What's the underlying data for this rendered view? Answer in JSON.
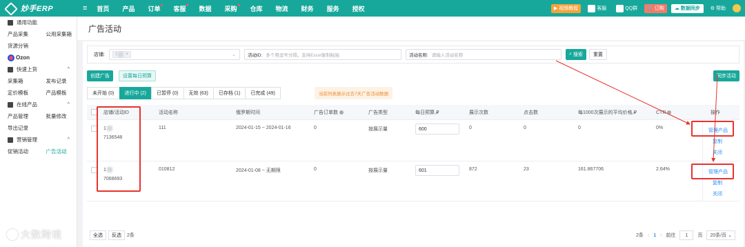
{
  "header": {
    "logo_text": "妙手ERP",
    "nav": [
      "首页",
      "产品",
      "订单",
      "客服",
      "数据",
      "采购",
      "仓库",
      "物流",
      "财务",
      "服务",
      "授权"
    ],
    "nav_dots": [
      false,
      false,
      true,
      true,
      false,
      true,
      false,
      false,
      false,
      false,
      false
    ],
    "video_tutorial": "视频教程",
    "customer_service": "客服",
    "qq_group": "QQ群",
    "subscribe": "订购",
    "data_sync": "数据同步",
    "help": "帮助"
  },
  "sidebar": {
    "general_section": "通用功能",
    "row1": [
      "产品采集",
      "公用采集箱"
    ],
    "row2": [
      "货源分销",
      ""
    ],
    "ozon": "Ozon",
    "quick_listing": "快速上货",
    "row3": [
      "采集箱",
      "发布记录"
    ],
    "row4": [
      "定价模板",
      "产品模板"
    ],
    "online_products": "在线产品",
    "row5": [
      "产品管理",
      "批量修改"
    ],
    "row6": [
      "导出记录",
      ""
    ],
    "marketing": "营销管理",
    "row7": [
      "促销活动",
      "广告活动"
    ]
  },
  "page": {
    "title": "广告活动"
  },
  "filters": {
    "shop_label": "店铺:",
    "shop_tag": "1",
    "activity_id_label": "活动ID:",
    "activity_id_placeholder": "多个用逗号分隔，支持Excel复制粘贴",
    "activity_name_label": "活动名称:",
    "activity_name_placeholder": "请输入活动名称",
    "search": "搜索",
    "reset": "重置"
  },
  "actions": {
    "create_ad": "创建广告",
    "set_daily_budget": "设置每日预算",
    "sync_activity": "同步活动"
  },
  "tabs": [
    {
      "label": "未开始 (0)",
      "active": false
    },
    {
      "label": "进行中 (2)",
      "active": true
    },
    {
      "label": "已暂停 (0)",
      "active": false
    },
    {
      "label": "无效 (63)",
      "active": false
    },
    {
      "label": "已存档 (1)",
      "active": false
    },
    {
      "label": "已完成 (49)",
      "active": false
    }
  ],
  "notice": "当前列表展示过去7天广告活动数据",
  "table": {
    "headers": {
      "shop_id": "店铺/活动ID",
      "name": "活动名称",
      "time": "俄罗斯时间",
      "orders": "广告订单数",
      "type": "广告类型",
      "budget": "每日预算,₽",
      "impressions": "展示次数",
      "clicks": "点击数",
      "cpm": "每1000次展示的平均价格,₽",
      "ctr": "CTR",
      "ops": "操作"
    },
    "rows": [
      {
        "shop": "1",
        "id": "7136548",
        "name": "111",
        "time": "2024-01-15 ~ 2024-01-16",
        "orders": "0",
        "type": "按展示量",
        "budget": "600",
        "impressions": "0",
        "clicks": "0",
        "cpm": "0",
        "ctr": "0%",
        "manage": "管理产品",
        "copy": "复制",
        "close": "关闭"
      },
      {
        "shop": "1",
        "id": "7068693",
        "name": "010812",
        "time": "2024-01-08 ~ 无期限",
        "orders": "0",
        "type": "按展示量",
        "budget": "601",
        "impressions": "872",
        "clicks": "23",
        "cpm": "161.867706",
        "ctr": "2.64%",
        "manage": "管理产品",
        "copy": "复制",
        "close": "关闭"
      }
    ]
  },
  "footer": {
    "select_all": "全选",
    "invert": "反选",
    "count": "2条",
    "total": "2条",
    "current_page": "1",
    "goto": "前往",
    "goto_value": "1",
    "page_unit": "页",
    "page_size": "20条/页"
  },
  "watermark": "大数跨境",
  "colors": {
    "brand": "#18a89b",
    "link": "#2c8ef8",
    "annotation_red": "#e8322c",
    "notice": "#f08a2c"
  }
}
